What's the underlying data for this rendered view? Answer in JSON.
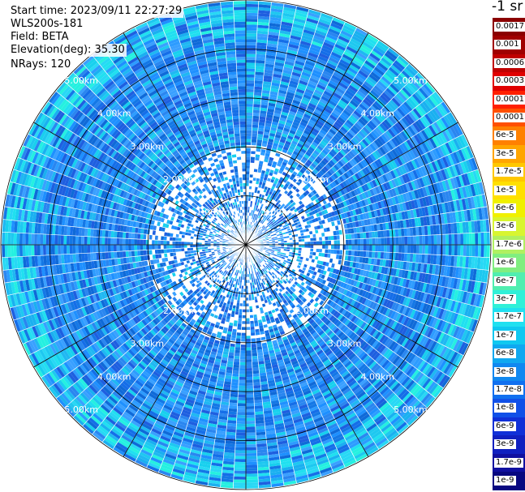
{
  "header": {
    "start_time": "Start time: 2023/09/11 22:27:29",
    "instrument": "WLS200s-181",
    "field": "Field: BETA",
    "elevation": "Elevation(deg): 35.30",
    "nrays": "NRays: 120"
  },
  "colorbar": {
    "units": "-1 sr",
    "ticks": [
      "0.0017",
      "0.001",
      "0.0006",
      "0.0003",
      "0.00017",
      "0.0001",
      "6e-5",
      "3e-5",
      "1.7e-5",
      "1e-5",
      "6e-6",
      "3e-6",
      "1.7e-6",
      "1e-6",
      "6e-7",
      "3e-7",
      "1.7e-7",
      "1e-7",
      "6e-8",
      "3e-8",
      "1.7e-8",
      "1e-8",
      "6e-9",
      "3e-9",
      "1.7e-9",
      "1e-9"
    ],
    "colors": [
      "#8b0000",
      "#a00000",
      "#c00000",
      "#e00000",
      "#ff2000",
      "#ff5000",
      "#ff8000",
      "#ffa500",
      "#ffc800",
      "#ffe000",
      "#f0f000",
      "#d8f530",
      "#b0f060",
      "#80ee80",
      "#50eeb0",
      "#30f0d8",
      "#20e0f0",
      "#10c8f0",
      "#10a8f0",
      "#1088f0",
      "#1070f0",
      "#1050e8",
      "#1030d8",
      "#1020c0",
      "#1010a0",
      "#080880"
    ]
  },
  "chart_data": {
    "type": "heatmap",
    "projection": "polar-ppi",
    "field": "BETA",
    "n_rays": 120,
    "range_rings_km": [
      1,
      2,
      3,
      4,
      5
    ],
    "range_ring_labels": [
      "1.00km",
      "2.00km",
      "3.00km",
      "4.00km",
      "5.00km"
    ],
    "max_range_km": 5.0,
    "azimuth_spokes": 12,
    "dominant_value_range": [
      "1e-8",
      "1e-7"
    ],
    "colorscale": "log"
  }
}
